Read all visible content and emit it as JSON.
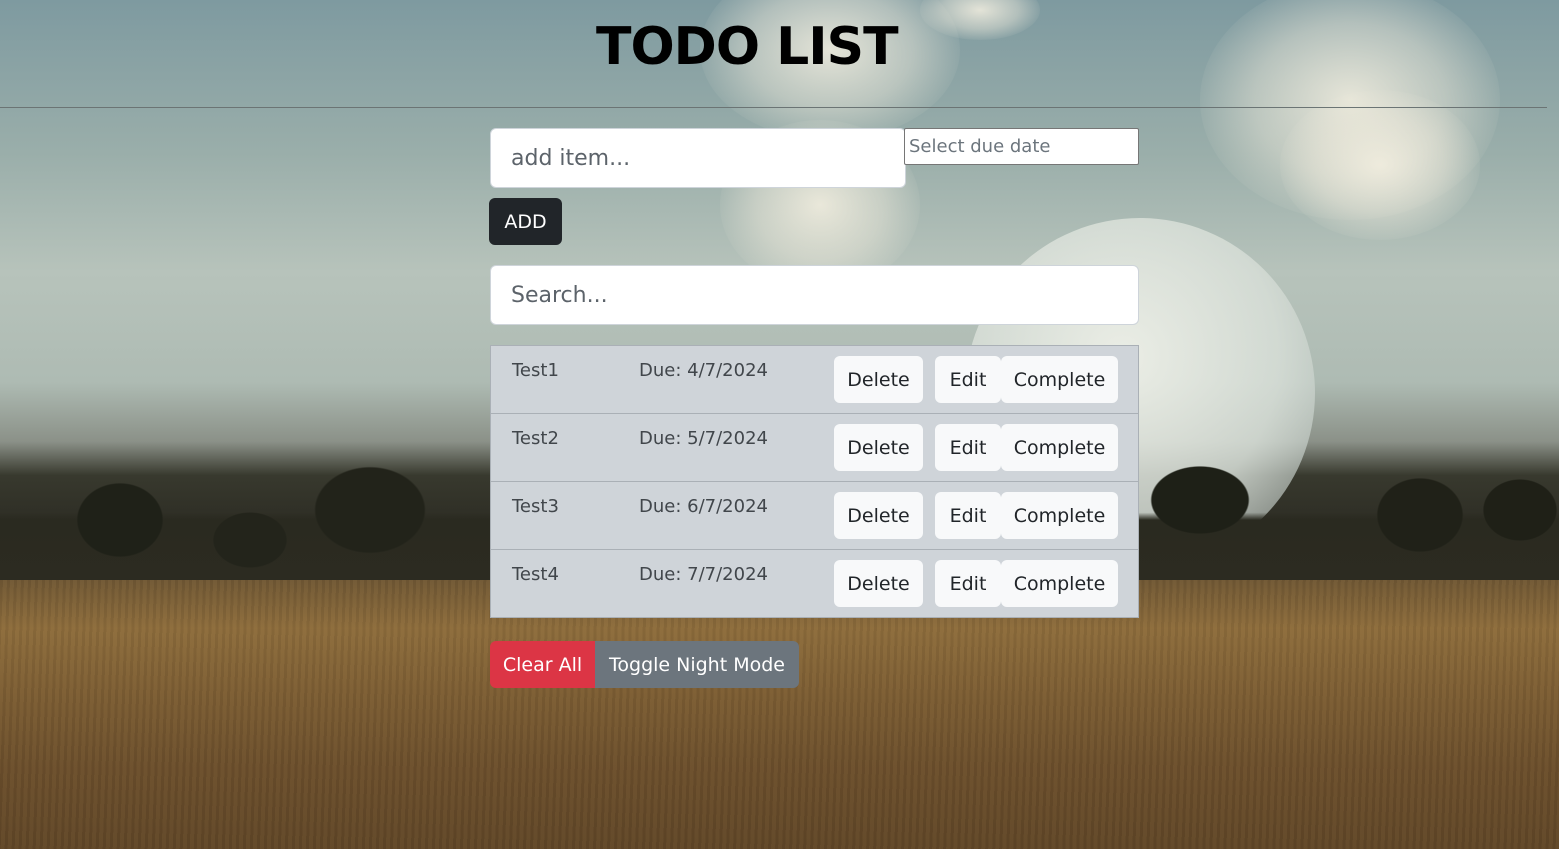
{
  "header": {
    "title": "TODO LIST"
  },
  "form": {
    "item_placeholder": "add item...",
    "date_placeholder": "Select due date",
    "add_label": "ADD"
  },
  "search": {
    "placeholder": "Search..."
  },
  "todos": [
    {
      "name": "Test1",
      "due": "Due: 4/7/2024",
      "delete_label": "Delete",
      "edit_label": "Edit",
      "complete_label": "Complete"
    },
    {
      "name": "Test2",
      "due": "Due: 5/7/2024",
      "delete_label": "Delete",
      "edit_label": "Edit",
      "complete_label": "Complete"
    },
    {
      "name": "Test3",
      "due": "Due: 6/7/2024",
      "delete_label": "Delete",
      "edit_label": "Edit",
      "complete_label": "Complete"
    },
    {
      "name": "Test4",
      "due": "Due: 7/7/2024",
      "delete_label": "Delete",
      "edit_label": "Edit",
      "complete_label": "Complete"
    }
  ],
  "footer": {
    "clear_label": "Clear All",
    "night_label": "Toggle Night Mode"
  },
  "colors": {
    "add_button": "#212529",
    "row_background": "#cfd4d9",
    "row_button": "#f8f9fa",
    "clear_button": "#dc3545",
    "night_button": "#6c757d"
  }
}
